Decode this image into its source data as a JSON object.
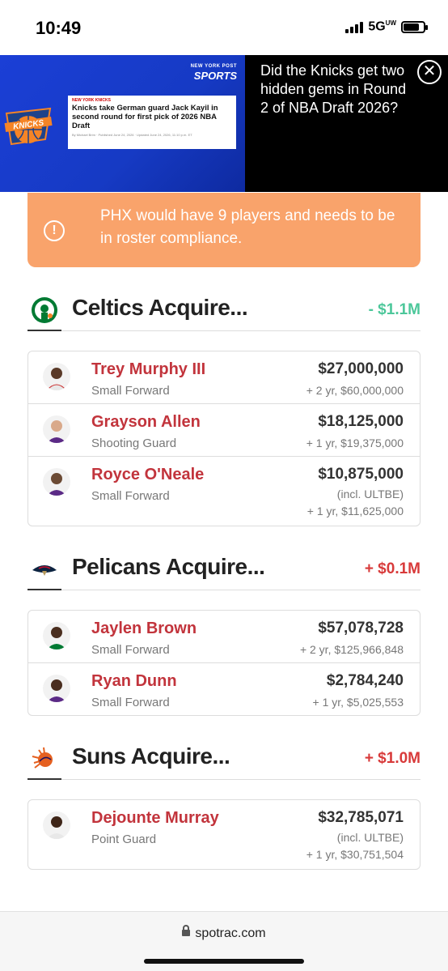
{
  "status": {
    "time": "10:49",
    "network": "5G",
    "network_sup": "UW"
  },
  "ad": {
    "brand": "SPORTS",
    "brand_small": "NEW YORK POST",
    "card_tag": "NEW YORK KNICKS",
    "card_headline": "Knicks take German guard Jack Kayil in second round for first pick of 2026 NBA Draft",
    "card_meta": "By Michael Brim · Published June 24, 2026 · Updated June 24, 2026, 11:10 p.m. ET",
    "headline": "Did the Knicks get two hidden gems in Round 2 of NBA Draft 2026?",
    "close_icon": "close-icon"
  },
  "alert": {
    "icon": "!",
    "text": "PHX would have 9 players and needs to be in roster compliance."
  },
  "sections": [
    {
      "title": "Celtics Acquire...",
      "cap": "- $1.1M",
      "cap_color": "#4cc79a",
      "players": [
        {
          "name": "Trey Murphy III",
          "position": "Small Forward",
          "amount": "$27,000,000",
          "sub1": "+ 2 yr, $60,000,000",
          "sub2": ""
        },
        {
          "name": "Grayson Allen",
          "position": "Shooting Guard",
          "amount": "$18,125,000",
          "sub1": "+ 1 yr, $19,375,000",
          "sub2": ""
        },
        {
          "name": "Royce O'Neale",
          "position": "Small Forward",
          "amount": "$10,875,000",
          "sub1": "(incl. ULTBE)",
          "sub2": "+ 1 yr, $11,625,000"
        }
      ]
    },
    {
      "title": "Pelicans Acquire...",
      "cap": "+ $0.1M",
      "cap_color": "#d83a3a",
      "players": [
        {
          "name": "Jaylen Brown",
          "position": "Small Forward",
          "amount": "$57,078,728",
          "sub1": "+ 2 yr, $125,966,848",
          "sub2": ""
        },
        {
          "name": "Ryan Dunn",
          "position": "Small Forward",
          "amount": "$2,784,240",
          "sub1": "+ 1 yr, $5,025,553",
          "sub2": ""
        }
      ]
    },
    {
      "title": "Suns Acquire...",
      "cap": "+ $1.0M",
      "cap_color": "#d83a3a",
      "players": [
        {
          "name": "Dejounte Murray",
          "position": "Point Guard",
          "amount": "$32,785,071",
          "sub1": "(incl. ULTBE)",
          "sub2": "+ 1 yr, $30,751,504"
        }
      ]
    }
  ],
  "browser": {
    "url": "spotrac.com"
  }
}
